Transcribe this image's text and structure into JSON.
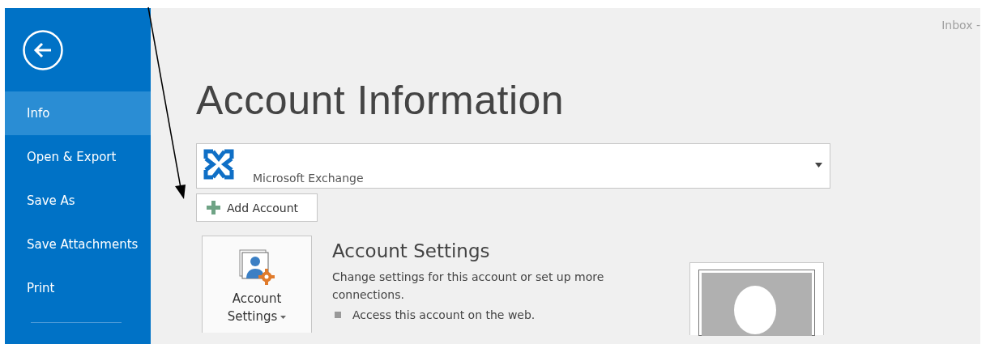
{
  "window": {
    "title": "Inbox -"
  },
  "sidebar": {
    "items": [
      {
        "label": "Info",
        "selected": true
      },
      {
        "label": "Open & Export",
        "selected": false
      },
      {
        "label": "Save As",
        "selected": false
      },
      {
        "label": "Save Attachments",
        "selected": false
      },
      {
        "label": "Print",
        "selected": false
      }
    ]
  },
  "page_title": "Account Information",
  "account": {
    "type": "Microsoft Exchange"
  },
  "add_account": "Add Account",
  "account_settings": {
    "button_lines": [
      "Account",
      "Settings"
    ],
    "title": "Account Settings",
    "description": "Change settings for this account or set up more connections.",
    "bullets": [
      "Access this account on the web."
    ]
  }
}
